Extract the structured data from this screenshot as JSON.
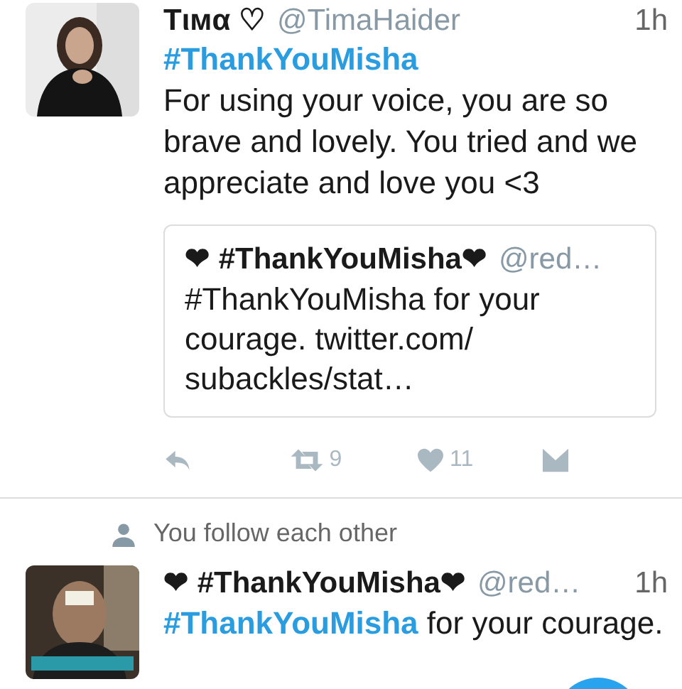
{
  "tweets": [
    {
      "name": "Tιмα ♡",
      "handle": "@TimaHaider",
      "time": "1h",
      "hashtag": "#ThankYouMisha",
      "text": "For using your voice, you are so brave and lovely. You tried and we appreciate and love you <3",
      "quote": {
        "name": "❤ #ThankYouMisha❤",
        "handle": "@red…",
        "text": "#ThankYouMisha for your courage. twitter.com/ subackles/stat…"
      },
      "actions": [
        {
          "kind": "reply"
        },
        {
          "kind": "retweet",
          "count": "9"
        },
        {
          "kind": "like",
          "count": "11"
        },
        {
          "kind": "message"
        }
      ]
    },
    {
      "context": "You follow each other",
      "name": "❤ #ThankYouMisha❤",
      "handle": "@red…",
      "time": "1h",
      "inline_hashtag": "#ThankYouMisha",
      "text": " for your courage."
    }
  ]
}
